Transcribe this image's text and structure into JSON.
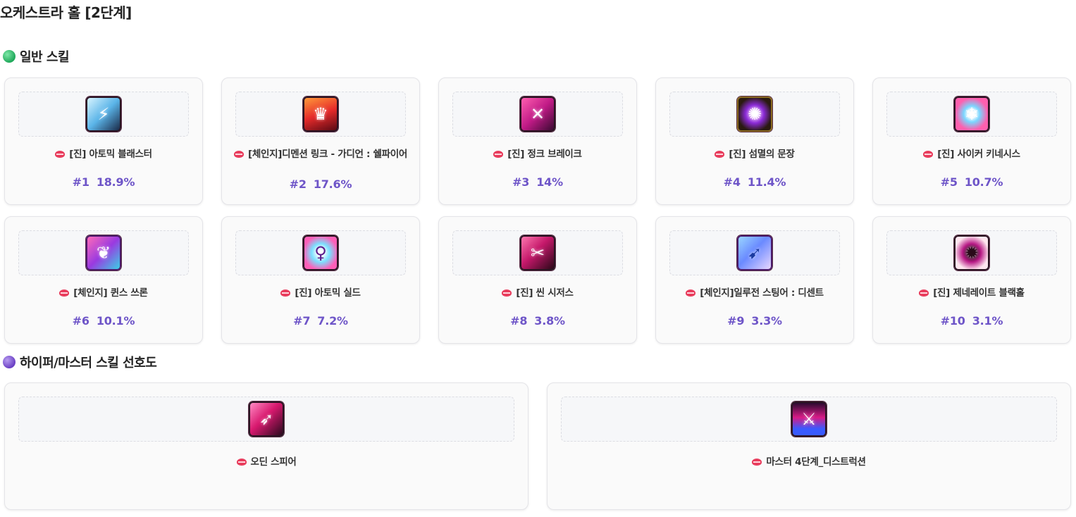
{
  "page": {
    "title": "오케스트라 홀 [2단계]"
  },
  "sections": {
    "normal": {
      "title": "일반 스킬"
    },
    "hyper": {
      "title": "하이퍼/마스터 스킬 선호도"
    }
  },
  "normal_skills": [
    {
      "name": "[진] 아토믹 블래스터",
      "rank": "#1",
      "percent": "18.9%",
      "icon": "lightning-icon"
    },
    {
      "name": "[체인지]디멘션 링크 - 가디언 : 쉘파이어",
      "rank": "#2",
      "percent": "17.6%",
      "icon": "flame-guardian-icon"
    },
    {
      "name": "[진] 정크 브레이크",
      "rank": "#3",
      "percent": "14%",
      "icon": "blade-icon"
    },
    {
      "name": "[진] 섬멸의 문장",
      "rank": "#4",
      "percent": "11.4%",
      "icon": "sigil-icon"
    },
    {
      "name": "[진] 사이커 키네시스",
      "rank": "#5",
      "percent": "10.7%",
      "icon": "snowflake-icon"
    },
    {
      "name": "[체인지] 퀸스 쓰론",
      "rank": "#6",
      "percent": "10.1%",
      "icon": "butterfly-icon"
    },
    {
      "name": "[진] 아토믹 실드",
      "rank": "#7",
      "percent": "7.2%",
      "icon": "shield-figure-icon"
    },
    {
      "name": "[진] 씬 시저스",
      "rank": "#8",
      "percent": "3.8%",
      "icon": "scissors-icon"
    },
    {
      "name": "[체인지]일루전 스팅어 : 디센트",
      "rank": "#9",
      "percent": "3.3%",
      "icon": "stinger-icon"
    },
    {
      "name": "[진] 제네레이트 블랙홀",
      "rank": "#10",
      "percent": "3.1%",
      "icon": "black-hole-icon"
    }
  ],
  "hyper_skills": [
    {
      "name": "오딘 스피어",
      "icon": "spear-icon"
    },
    {
      "name": "마스터 4단계_디스트럭션",
      "icon": "destruction-icon"
    }
  ],
  "colors": {
    "rank": "#6e55c8",
    "lips": "#e83c5c",
    "normal_dot": "#1fa85a",
    "hyper_dot": "#6a3fc4"
  }
}
